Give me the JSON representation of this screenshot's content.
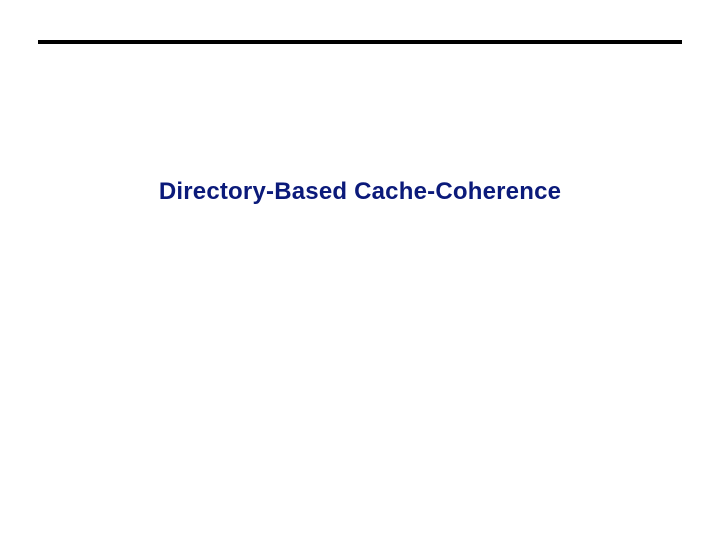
{
  "slide": {
    "title": "Directory-Based Cache-Coherence"
  }
}
